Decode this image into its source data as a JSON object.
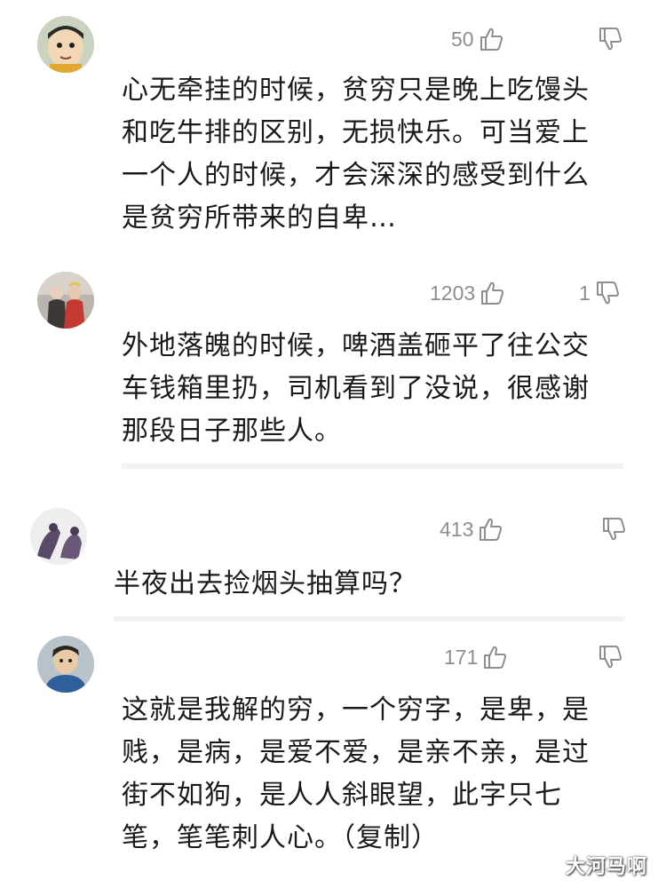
{
  "comments": [
    {
      "likes": "50",
      "dislikes": "",
      "lines": [
        "心无牵挂的时候，贫穷只是晚上吃馒头",
        "和吃牛排的区别，无损快乐。可当爱上",
        "一个人的时候，才会深深的感受到什么",
        "是贫穷所带来的自卑…"
      ]
    },
    {
      "likes": "1203",
      "dislikes": "1",
      "lines": [
        "外地落魄的时候，啤酒盖砸平了往公交",
        "车钱箱里扔，司机看到了没说，很感谢",
        "那段日子那些人。"
      ]
    },
    {
      "likes": "413",
      "dislikes": "",
      "lines": [
        "半夜出去捡烟头抽算吗？"
      ]
    },
    {
      "likes": "171",
      "dislikes": "",
      "lines": [
        "这就是我解的穷，一个穷字，是卑，是",
        "贱，是病，是爱不爱，是亲不亲，是过",
        "街不如狗，是人人斜眼望，此字只七",
        "笔，笔笔刺人心。（复制）"
      ]
    }
  ],
  "icons": {
    "like": "thumbs-up-icon",
    "dislike": "thumbs-down-icon"
  },
  "colors": {
    "text": "#1a1a1a",
    "meta": "#8e8e8e",
    "divider": "#f2f2f2"
  },
  "watermark": "大河马啊"
}
